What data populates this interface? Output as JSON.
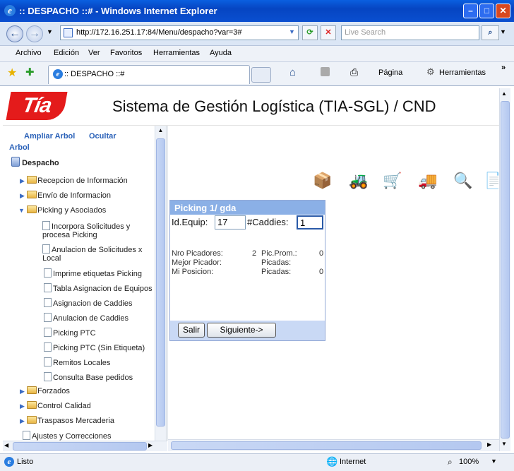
{
  "window": {
    "title": ":: DESPACHO ::# - Windows Internet Explorer"
  },
  "address": {
    "url": "http://172.16.251.17:84/Menu/despacho?var=3#",
    "search_placeholder": "Live Search"
  },
  "menu": [
    "Archivo",
    "Edición",
    "Ver",
    "Favoritos",
    "Herramientas",
    "Ayuda"
  ],
  "tab": {
    "label": ":: DESPACHO ::#"
  },
  "commandbar": {
    "page": "Página",
    "tools": "Herramientas"
  },
  "header": {
    "logo": "Tía",
    "title": "Sistema de Gestión Logística (TIA-SGL) / CND"
  },
  "sidebar": {
    "expand": "Ampliar Arbol",
    "hide": "Ocultar",
    "tree_label": "Arbol",
    "root": "Despacho",
    "folders": [
      "Recepcion de Información",
      "Envío de Informacion",
      "Picking y Asociados",
      "Forzados",
      "Control Calidad",
      "Traspasos Mercaderia"
    ],
    "items": [
      "Incorpora Solicitudes y procesa Picking",
      "Anulacion de Solicitudes x Local",
      "Imprime etiquetas Picking",
      "Tabla Asignacion de Equipos",
      "Asignacion de Caddies",
      "Anulacion de Caddies",
      "Picking PTC",
      "Picking PTC (Sin Etiqueta)",
      "Remitos Locales",
      "Consulta Base pedidos"
    ],
    "last": "Ajustes y Correcciones"
  },
  "panel": {
    "title": "Picking 1/ gda",
    "equip_label": "Id.Equip:",
    "equip_value": "17",
    "caddies_label": "#Caddies:",
    "caddies_value": "1",
    "rows": [
      {
        "l1": "Nro Picadores:",
        "v1": "2",
        "l2": "Pic.Prom.:",
        "v2": "0"
      },
      {
        "l1": "Mejor Picador:",
        "v1": "",
        "l2": "Picadas:",
        "v2": ""
      },
      {
        "l1": "Mi Posicion:",
        "v1": "",
        "l2": "Picadas:",
        "v2": "0"
      }
    ],
    "exit": "Salir",
    "next": "Siguiente->"
  },
  "status": {
    "left": "Listo",
    "zone": "Internet",
    "zoom": "100%"
  }
}
